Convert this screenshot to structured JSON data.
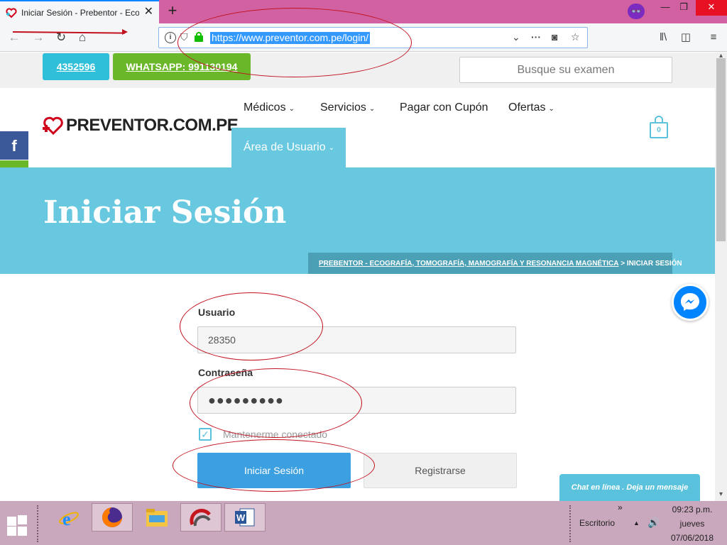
{
  "browser": {
    "tab_title": "Iniciar Sesión - Prebentor - Eco",
    "close_glyph": "✕",
    "newtab_glyph": "+",
    "private_glyph": "👓",
    "url": "https://www.preventor.com.pe/login/",
    "win_min": "—",
    "win_max": "❐",
    "win_close": "✕"
  },
  "topbar": {
    "phone": "4352596",
    "whatsapp": "WHATSAPP: 991130194",
    "search_placeholder": "Busque su examen"
  },
  "logo": {
    "text": "PREVENTOR.COM.PE"
  },
  "menu": {
    "medicos": "Médicos",
    "servicios": "Servicios",
    "cupon": "Pagar con Cupón",
    "ofertas": "Ofertas",
    "usuario": "Área de Usuario",
    "chevron": "⌄"
  },
  "cart": {
    "count": "0"
  },
  "social": {
    "facebook": "f"
  },
  "banner": {
    "title": "Iniciar Sesión",
    "crumb_link": "PREBENTOR - ECOGRAFÍA, TOMOGRAFÍA, MAMOGRAFÍA Y RESONANCIA MAGNÉTICA",
    "crumb_sep": " > ",
    "crumb_current": "INICIAR SESIÓN"
  },
  "form": {
    "user_label": "Usuario",
    "user_value": "28350",
    "password_label": "Contraseña",
    "password_value": "●●●●●●●●●",
    "remember": "Mantenerme conectado",
    "login_button": "Iniciar Sesión",
    "register_button": "Registrarse"
  },
  "chat": {
    "label": "Chat en línea . Deja un mensaje"
  },
  "taskbar": {
    "tray_label": "Escritorio",
    "tray_chevron": "»",
    "time": "09:23 p.m.",
    "day": "jueves",
    "date": "07/06/2018"
  },
  "colors": {
    "tab_strip": "#d161a1",
    "banner": "#67c8df",
    "crumb": "#4ba0b5",
    "login_button": "#3b9fe0",
    "whatsapp_button": "#6ab729",
    "phone_button": "#2fbfd9",
    "annotation": "#c1121f"
  }
}
